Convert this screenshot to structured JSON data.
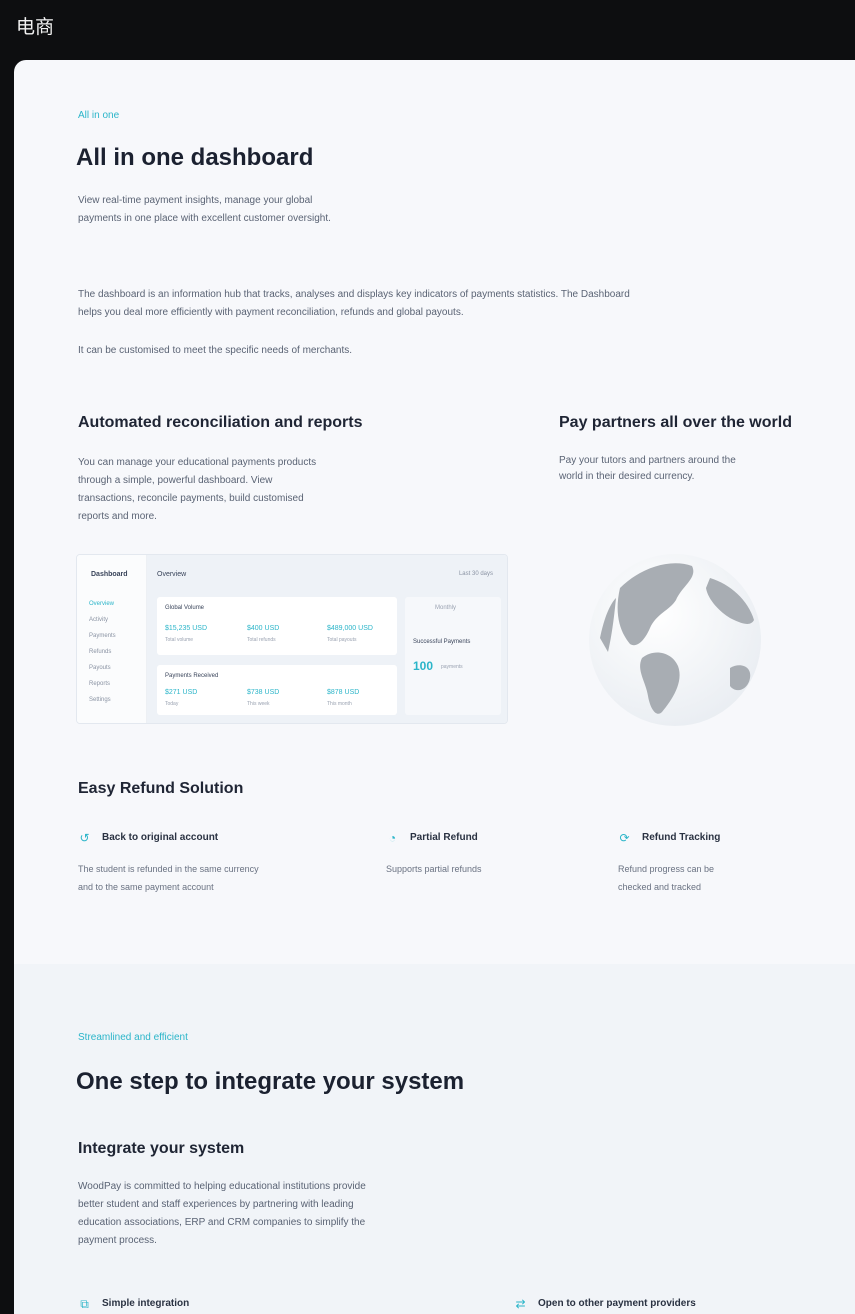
{
  "window": {
    "title": "电商"
  },
  "hero": {
    "eyebrow": "All in one",
    "title": "All in one dashboard",
    "intro_line1": "View real-time payment insights, manage your global",
    "intro_line2": "payments in one place with excellent customer oversight.",
    "desc_line1": "The dashboard is an information hub that tracks, analyses and displays key indicators of payments statistics. The Dashboard",
    "desc_line2": "helps you deal more efficiently with payment reconciliation, refunds and global payouts.",
    "desc_line3": "It can be customised to meet the specific needs of merchants."
  },
  "reconciliation": {
    "title": "Automated reconciliation and reports",
    "line1": "You can manage your educational payments products",
    "line2": "through a simple, powerful dashboard. View",
    "line3": "transactions, reconcile payments, build customised",
    "line4": "reports and more."
  },
  "partners": {
    "title": "Pay partners all over the world",
    "line1": "Pay your tutors and partners around the",
    "line2": "world in their desired currency."
  },
  "dashboard_mock": {
    "logo": "Dashboard",
    "nav": [
      "Overview",
      "Activity",
      "Payments",
      "Refunds",
      "Payouts",
      "Reports",
      "Settings"
    ],
    "header": "Overview",
    "header_right": "Last 30 days",
    "card1_title": "Global Volume",
    "card1_stats": [
      {
        "value": "$15,235 USD",
        "label": "Total volume"
      },
      {
        "value": "$400 USD",
        "label": "Total refunds"
      },
      {
        "value": "$489,000 USD",
        "label": "Total payouts"
      }
    ],
    "card2_title": "Payments Received",
    "card2_stats": [
      {
        "value": "$271 USD",
        "label": "Today"
      },
      {
        "value": "$738 USD",
        "label": "This week"
      },
      {
        "value": "$878 USD",
        "label": "This month"
      }
    ],
    "side_label": "Successful Payments",
    "side_value": "100",
    "side_unit": "payments",
    "side_filter": "Monthly"
  },
  "refund": {
    "title": "Easy Refund Solution",
    "items": [
      {
        "title": "Back to original account",
        "line1": "The student is refunded in the same currency",
        "line2": "and to the same payment account"
      },
      {
        "title": "Partial Refund",
        "line1": "Supports partial refunds",
        "line2": ""
      },
      {
        "title": "Refund Tracking",
        "line1": "Refund progress can be",
        "line2": "checked and tracked"
      }
    ]
  },
  "integration": {
    "eyebrow": "Streamlined and efficient",
    "title": "One step to integrate your system",
    "subtitle": "Integrate your system",
    "line1": "WoodPay is committed to helping educational institutions provide",
    "line2": "better student and staff experiences by partnering with leading",
    "line3": "education associations, ERP and CRM companies to simplify the",
    "line4": "payment process.",
    "feature_left": "Simple integration",
    "feature_right": "Open to other payment providers"
  },
  "colors": {
    "accent": "#2bb5c9",
    "panel": "#f7f8fb",
    "dark": "#0d0e10"
  }
}
